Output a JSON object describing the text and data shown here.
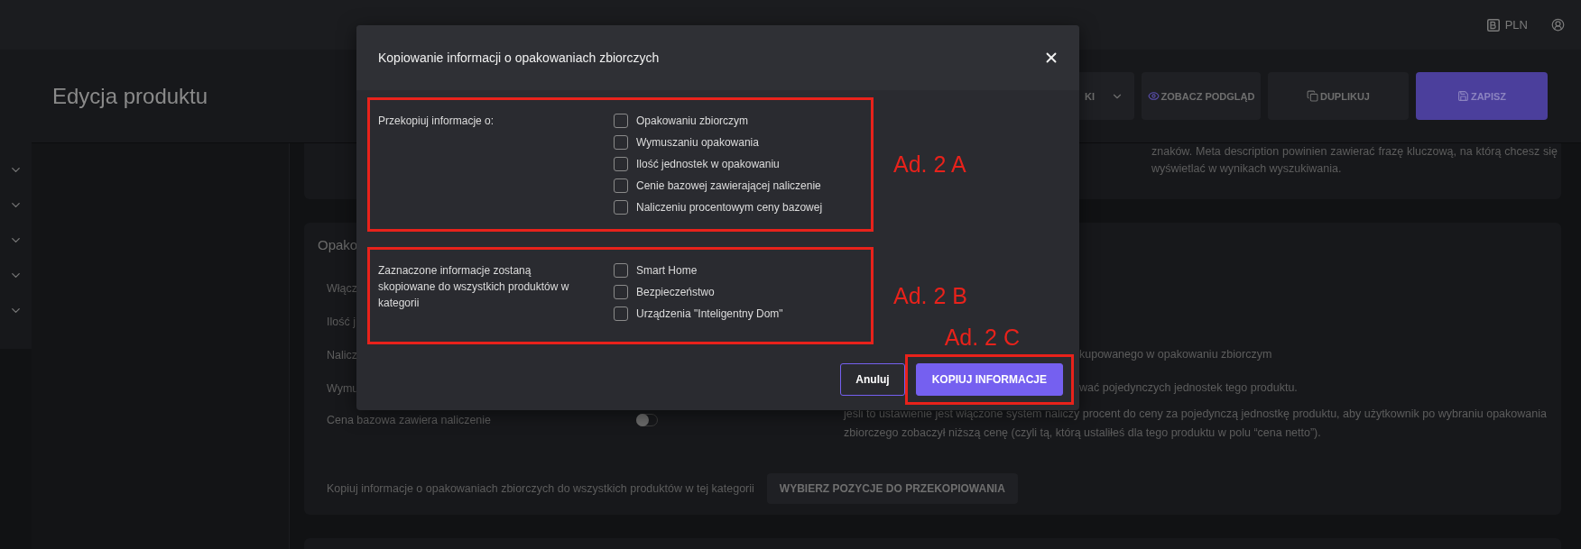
{
  "top_bar": {
    "currency": "PLN"
  },
  "header": {
    "title": "Edycja produktu",
    "dropdown": {
      "label": "KI"
    },
    "buttons": [
      {
        "label": "ZOBACZ PODGLĄD",
        "kind": "preview"
      },
      {
        "label": "DUPLIKUJ",
        "kind": "duplicate"
      },
      {
        "label": "ZAPISZ",
        "kind": "save"
      }
    ]
  },
  "meta_card": {
    "help_text": "znaków. Meta description powinien zawierać frazę kluczową, na którą chcesz się wyświetlać w wynikach wyszukiwania."
  },
  "packaging_card": {
    "title": "Opako",
    "rows": [
      {
        "label": "Włącz"
      },
      {
        "label": "Ilość j"
      },
      {
        "label": "Nalicz",
        "description": "kupowanego w opakowaniu zbiorczym"
      },
      {
        "label": "Wymu",
        "description": "wać pojedynczych jednostek tego produktu."
      },
      {
        "label": "Cena bazowa zawiera naliczenie",
        "toggle": {
          "on": false
        },
        "description": "jeśli to ustawienie jest włączone system naliczy procent do ceny za pojedynczą jednostkę produktu, aby użytkownik po wybraniu opakowania zbiorczego zobaczył niższą cenę (czyli tą, którą ustaliłeś dla tego produktu w polu “cena netto”)."
      }
    ],
    "copy_text": "Kopiuj informacje o opakowaniach zbiorczych do wszystkich produktów w tej kategorii",
    "copy_button": "WYBIERZ POZYCJE DO PRZEKOPIOWANIA"
  },
  "dialog": {
    "title": "Kopiowanie informacji o opakowaniach zbiorczych",
    "sections": [
      {
        "label": "Przekopiuj informacje o:",
        "annotation": "Ad. 2 A",
        "options": [
          {
            "label": "Opakowaniu zbiorczym",
            "checked": false
          },
          {
            "label": "Wymuszaniu opakowania",
            "checked": false
          },
          {
            "label": "Ilość jednostek w opakowaniu",
            "checked": false
          },
          {
            "label": "Cenie bazowej zawierającej naliczenie",
            "checked": false
          },
          {
            "label": "Naliczeniu procentowym ceny bazowej",
            "checked": false
          }
        ]
      },
      {
        "label": "Zaznaczone informacje zostaną skopiowane do wszystkich produktów w kategorii",
        "annotation": "Ad. 2 B",
        "options": [
          {
            "label": "Smart Home",
            "checked": false
          },
          {
            "label": "Bezpieczeństwo",
            "checked": false
          },
          {
            "label": "Urządzenia \"Inteligentny Dom\"",
            "checked": false
          }
        ]
      }
    ],
    "buttons": [
      {
        "label": "Anuluj",
        "kind": "secondary"
      },
      {
        "label": "KOPIUJ INFORMACJE",
        "kind": "primary",
        "annotation": "Ad. 2 C"
      }
    ]
  }
}
